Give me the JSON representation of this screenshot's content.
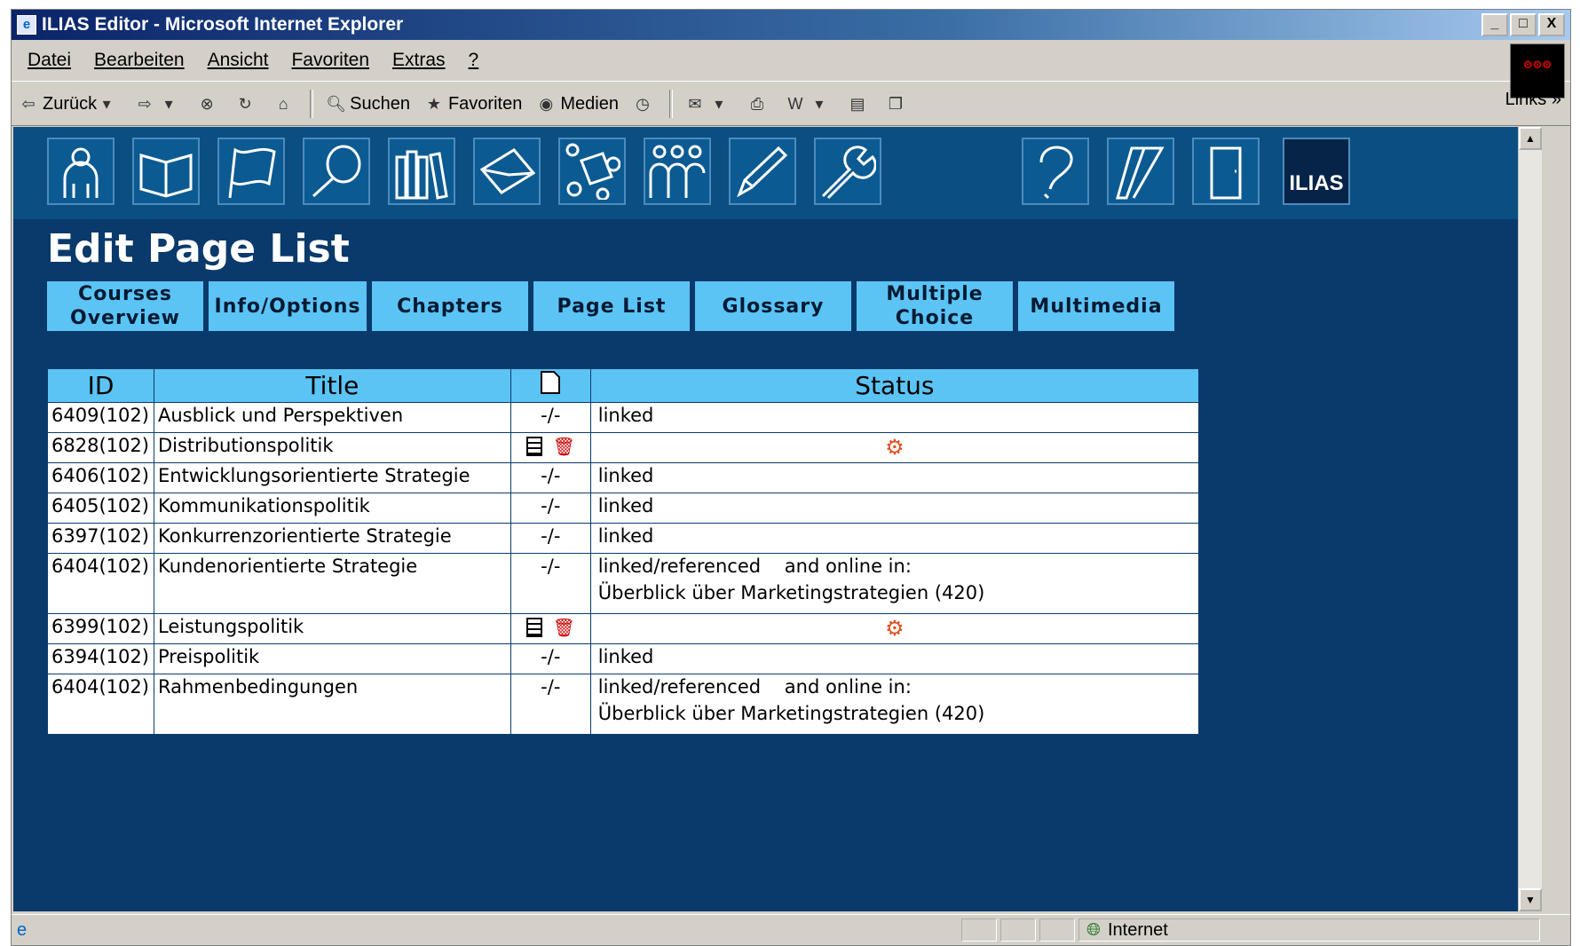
{
  "window": {
    "title": "ILIAS Editor - Microsoft Internet Explorer",
    "min": "_",
    "max": "□",
    "close": "X"
  },
  "menu": {
    "items": [
      "Datei",
      "Bearbeiten",
      "Ansicht",
      "Favoriten",
      "Extras",
      "?"
    ]
  },
  "toolbar": {
    "back": "Zurück",
    "search": "Suchen",
    "favorites": "Favoriten",
    "media": "Medien",
    "links": "Links"
  },
  "nav_icons": [
    "person-icon",
    "book-icon",
    "flag-icon",
    "magnifier-icon",
    "library-icon",
    "mail-icon",
    "shapes-icon",
    "group-icon",
    "pencil-icon",
    "wrench-icon",
    "help-icon",
    "feedback-icon",
    "exit-door-icon"
  ],
  "logo": "ILIAS",
  "page": {
    "title": "Edit Page List"
  },
  "tabs": [
    {
      "l1": "Courses",
      "l2": "Overview"
    },
    {
      "l1": "Info/Options",
      "l2": ""
    },
    {
      "l1": "Chapters",
      "l2": ""
    },
    {
      "l1": "Page List",
      "l2": ""
    },
    {
      "l1": "Glossary",
      "l2": ""
    },
    {
      "l1": "Multiple",
      "l2": "Choice"
    },
    {
      "l1": "Multimedia",
      "l2": ""
    }
  ],
  "table": {
    "headers": {
      "id": "ID",
      "title": "Title",
      "status": "Status"
    },
    "rows": [
      {
        "id": "6409(102)",
        "title": "Ausblick und Perspektiven",
        "action": "-/-",
        "status1": "linked",
        "status2": ""
      },
      {
        "id": "6828(102)",
        "title": "Distributionspolitik",
        "action": "",
        "status1": "",
        "status2": ""
      },
      {
        "id": "6406(102)",
        "title": "Entwicklungsorientierte Strategie",
        "action": "-/-",
        "status1": "linked",
        "status2": ""
      },
      {
        "id": "6405(102)",
        "title": "Kommunikationspolitik",
        "action": "-/-",
        "status1": "linked",
        "status2": ""
      },
      {
        "id": "6397(102)",
        "title": "Konkurrenzorientierte Strategie",
        "action": "-/-",
        "status1": "linked",
        "status2": ""
      },
      {
        "id": "6404(102)",
        "title": "Kundenorientierte Strategie",
        "action": "-/-",
        "status1": "linked/referenced    and online in:",
        "status2": "Überblick über Marketingstrategien (420)"
      },
      {
        "id": "6399(102)",
        "title": "Leistungspolitik",
        "action": "",
        "status1": "",
        "status2": ""
      },
      {
        "id": "6394(102)",
        "title": "Preispolitik",
        "action": "-/-",
        "status1": "linked",
        "status2": ""
      },
      {
        "id": "6404(102)",
        "title": "Rahmenbedingungen",
        "action": "-/-",
        "status1": "linked/referenced    and online in:",
        "status2": "Überblick über Marketingstrategien (420)"
      }
    ]
  },
  "statusbar": {
    "zone": "Internet"
  }
}
